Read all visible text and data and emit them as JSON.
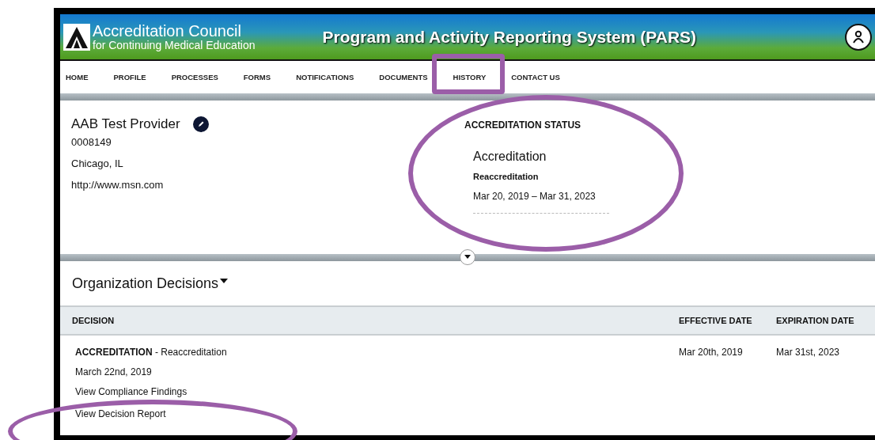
{
  "header": {
    "logo_line_1": "Accreditation Council",
    "logo_line_2": "for Continuing Medical Education",
    "title": "Program and Activity Reporting System (PARS)"
  },
  "nav": [
    {
      "label": "HOME"
    },
    {
      "label": "PROFILE"
    },
    {
      "label": "PROCESSES"
    },
    {
      "label": "FORMS"
    },
    {
      "label": "NOTIFICATIONS"
    },
    {
      "label": "DOCUMENTS"
    },
    {
      "label": "HISTORY"
    },
    {
      "label": "CONTACT US"
    }
  ],
  "provider": {
    "name": "AAB Test Provider",
    "id": "0008149",
    "location": "Chicago, IL",
    "website": "http://www.msn.com"
  },
  "status": {
    "heading": "ACCREDITATION STATUS",
    "type": "Accreditation",
    "subtype": "Reaccreditation",
    "dates": "Mar 20, 2019 – Mar 31, 2023"
  },
  "section": {
    "title": "Organization Decisions"
  },
  "table": {
    "columns": [
      "DECISION",
      "EFFECTIVE DATE",
      "EXPIRATION DATE"
    ],
    "rows": [
      {
        "decision": "**ACCREDITATION** - Reaccreditation",
        "date": "March 22nd, 2019",
        "links": [
          "View Compliance Findings",
          "View Decision Report"
        ],
        "effective": "Mar 20th, 2019",
        "expiration": "Mar 31st, 2023"
      }
    ]
  },
  "annotations": [
    {
      "kind": "box"
    },
    {
      "kind": "oval"
    },
    {
      "kind": "oval"
    }
  ]
}
